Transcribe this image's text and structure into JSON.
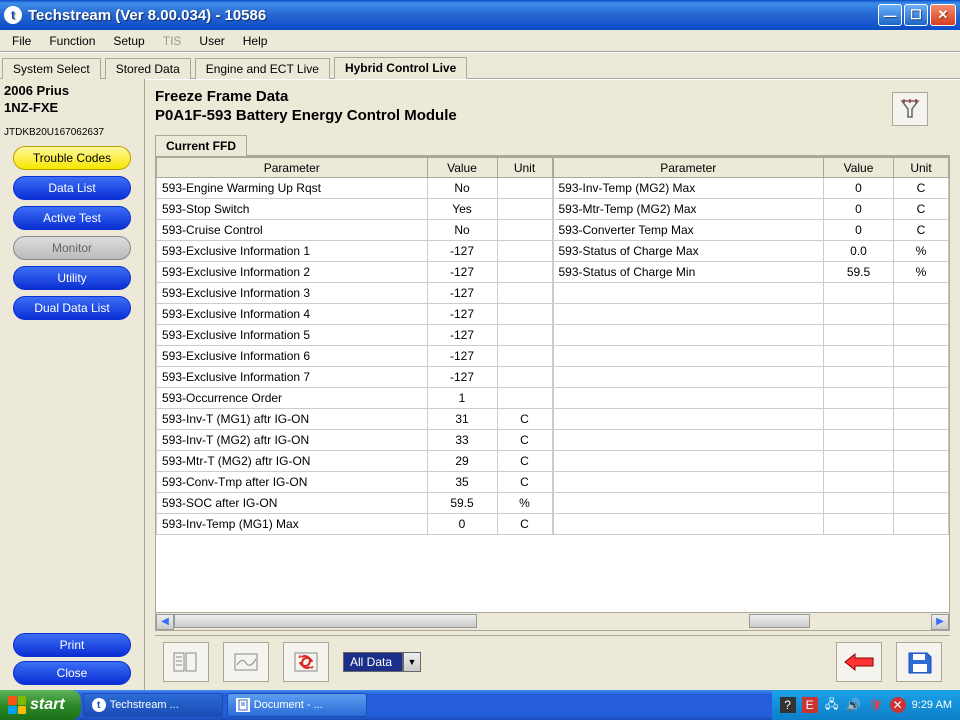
{
  "window": {
    "title": "Techstream (Ver 8.00.034) - 10586"
  },
  "menu": [
    "File",
    "Function",
    "Setup",
    "TIS",
    "User",
    "Help"
  ],
  "menu_disabled_index": 3,
  "tabs": [
    "System Select",
    "Stored Data",
    "Engine and ECT Live",
    "Hybrid Control Live"
  ],
  "active_tab_index": 3,
  "sidebar": {
    "vehicle_line1": "2006 Prius",
    "vehicle_line2": "1NZ-FXE",
    "vin": "JTDKB20U167062637",
    "buttons": [
      {
        "label": "Trouble Codes",
        "style": "yellow"
      },
      {
        "label": "Data List",
        "style": "blue"
      },
      {
        "label": "Active Test",
        "style": "blue"
      },
      {
        "label": "Monitor",
        "style": "gray"
      },
      {
        "label": "Utility",
        "style": "blue"
      },
      {
        "label": "Dual Data List",
        "style": "blue"
      }
    ],
    "bottom": [
      {
        "label": "Print",
        "style": "blue"
      },
      {
        "label": "Close",
        "style": "blue"
      }
    ]
  },
  "content": {
    "heading": "Freeze Frame Data",
    "subheading": "P0A1F-593 Battery Energy Control Module",
    "ffd_tab": "Current FFD",
    "headers": {
      "param": "Parameter",
      "value": "Value",
      "unit": "Unit"
    },
    "left_rows": [
      {
        "p": "593-Engine Warming Up Rqst",
        "v": "No",
        "u": ""
      },
      {
        "p": "593-Stop Switch",
        "v": "Yes",
        "u": ""
      },
      {
        "p": "593-Cruise Control",
        "v": "No",
        "u": ""
      },
      {
        "p": "593-Exclusive Information 1",
        "v": "-127",
        "u": ""
      },
      {
        "p": "593-Exclusive Information 2",
        "v": "-127",
        "u": ""
      },
      {
        "p": "593-Exclusive Information 3",
        "v": "-127",
        "u": ""
      },
      {
        "p": "593-Exclusive Information 4",
        "v": "-127",
        "u": ""
      },
      {
        "p": "593-Exclusive Information 5",
        "v": "-127",
        "u": ""
      },
      {
        "p": "593-Exclusive Information 6",
        "v": "-127",
        "u": ""
      },
      {
        "p": "593-Exclusive Information 7",
        "v": "-127",
        "u": ""
      },
      {
        "p": "593-Occurrence Order",
        "v": "1",
        "u": ""
      },
      {
        "p": "593-Inv-T (MG1) aftr IG-ON",
        "v": "31",
        "u": "C"
      },
      {
        "p": "593-Inv-T (MG2) aftr IG-ON",
        "v": "33",
        "u": "C"
      },
      {
        "p": "593-Mtr-T (MG2) aftr IG-ON",
        "v": "29",
        "u": "C"
      },
      {
        "p": "593-Conv-Tmp after IG-ON",
        "v": "35",
        "u": "C"
      },
      {
        "p": "593-SOC after IG-ON",
        "v": "59.5",
        "u": "%"
      },
      {
        "p": "593-Inv-Temp (MG1) Max",
        "v": "0",
        "u": "C"
      }
    ],
    "right_rows": [
      {
        "p": "593-Inv-Temp (MG2) Max",
        "v": "0",
        "u": "C"
      },
      {
        "p": "593-Mtr-Temp (MG2) Max",
        "v": "0",
        "u": "C"
      },
      {
        "p": "593-Converter Temp Max",
        "v": "0",
        "u": "C"
      },
      {
        "p": "593-Status of Charge Max",
        "v": "0.0",
        "u": "%"
      },
      {
        "p": "593-Status of Charge Min",
        "v": "59.5",
        "u": "%"
      },
      {
        "p": "",
        "v": "",
        "u": ""
      },
      {
        "p": "",
        "v": "",
        "u": ""
      },
      {
        "p": "",
        "v": "",
        "u": ""
      },
      {
        "p": "",
        "v": "",
        "u": ""
      },
      {
        "p": "",
        "v": "",
        "u": ""
      },
      {
        "p": "",
        "v": "",
        "u": ""
      },
      {
        "p": "",
        "v": "",
        "u": ""
      },
      {
        "p": "",
        "v": "",
        "u": ""
      },
      {
        "p": "",
        "v": "",
        "u": ""
      },
      {
        "p": "",
        "v": "",
        "u": ""
      },
      {
        "p": "",
        "v": "",
        "u": ""
      },
      {
        "p": "",
        "v": "",
        "u": ""
      }
    ],
    "combo": "All Data"
  },
  "taskbar": {
    "start": "start",
    "items": [
      "Techstream ...",
      "Document - ..."
    ],
    "clock": "9:29 AM"
  }
}
